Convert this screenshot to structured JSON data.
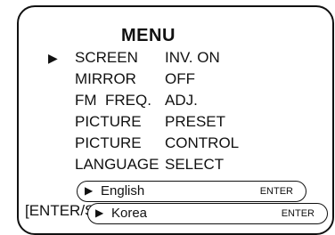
{
  "menu": {
    "title": "MENU",
    "selected_marker": "▶",
    "items": [
      {
        "label": "SCREEN",
        "value": "INV. ON",
        "selected": true
      },
      {
        "label": "MIRROR",
        "value": "OFF",
        "selected": false
      },
      {
        "label": "FM  FREQ.",
        "value": "ADJ.",
        "selected": false
      },
      {
        "label": "PICTURE",
        "value": "PRESET",
        "selected": false
      },
      {
        "label": "PICTURE",
        "value": "CONTROL",
        "selected": false
      },
      {
        "label": "LANGUAGE",
        "value": "SELECT",
        "selected": false
      }
    ],
    "footer_visible": "[ENTER/S"
  },
  "language_options": [
    {
      "marker": "▶",
      "label": "English",
      "action": "ENTER"
    },
    {
      "marker": "▶",
      "label": "Korea",
      "action": "ENTER"
    }
  ]
}
